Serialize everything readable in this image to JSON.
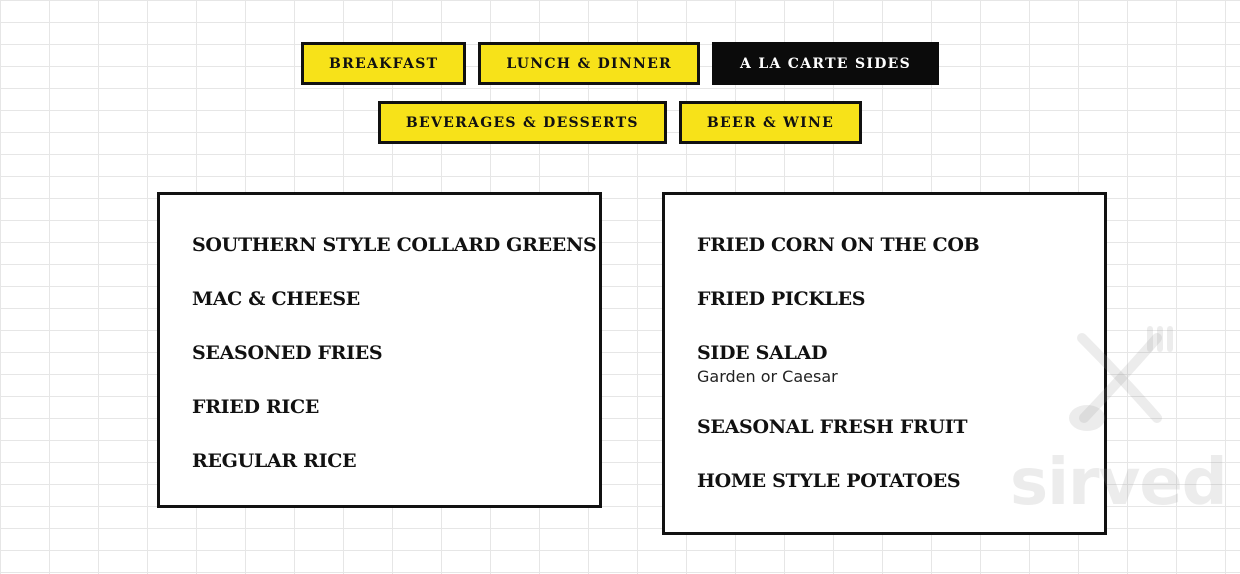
{
  "tabs": [
    {
      "label": "BREAKFAST",
      "active": false
    },
    {
      "label": "LUNCH & DINNER",
      "active": false
    },
    {
      "label": "A LA CARTE SIDES",
      "active": true
    },
    {
      "label": "BEVERAGES & DESSERTS",
      "active": false
    },
    {
      "label": "BEER & WINE",
      "active": false
    }
  ],
  "menu": {
    "left": [
      {
        "name": "SOUTHERN STYLE COLLARD GREENS"
      },
      {
        "name": "MAC & CHEESE"
      },
      {
        "name": "SEASONED FRIES"
      },
      {
        "name": "FRIED RICE"
      },
      {
        "name": "REGULAR RICE"
      }
    ],
    "right": [
      {
        "name": "FRIED CORN ON THE COB"
      },
      {
        "name": "FRIED PICKLES"
      },
      {
        "name": "SIDE SALAD",
        "description": "Garden or Caesar"
      },
      {
        "name": "SEASONAL FRESH FRUIT"
      },
      {
        "name": "HOME STYLE POTATOES"
      }
    ]
  },
  "watermark": {
    "text": "sirved",
    "icon": "utensils-icon"
  },
  "colors": {
    "tab_background": "#f7e219",
    "active_tab_background": "#0b0b0b",
    "border": "#111111"
  }
}
